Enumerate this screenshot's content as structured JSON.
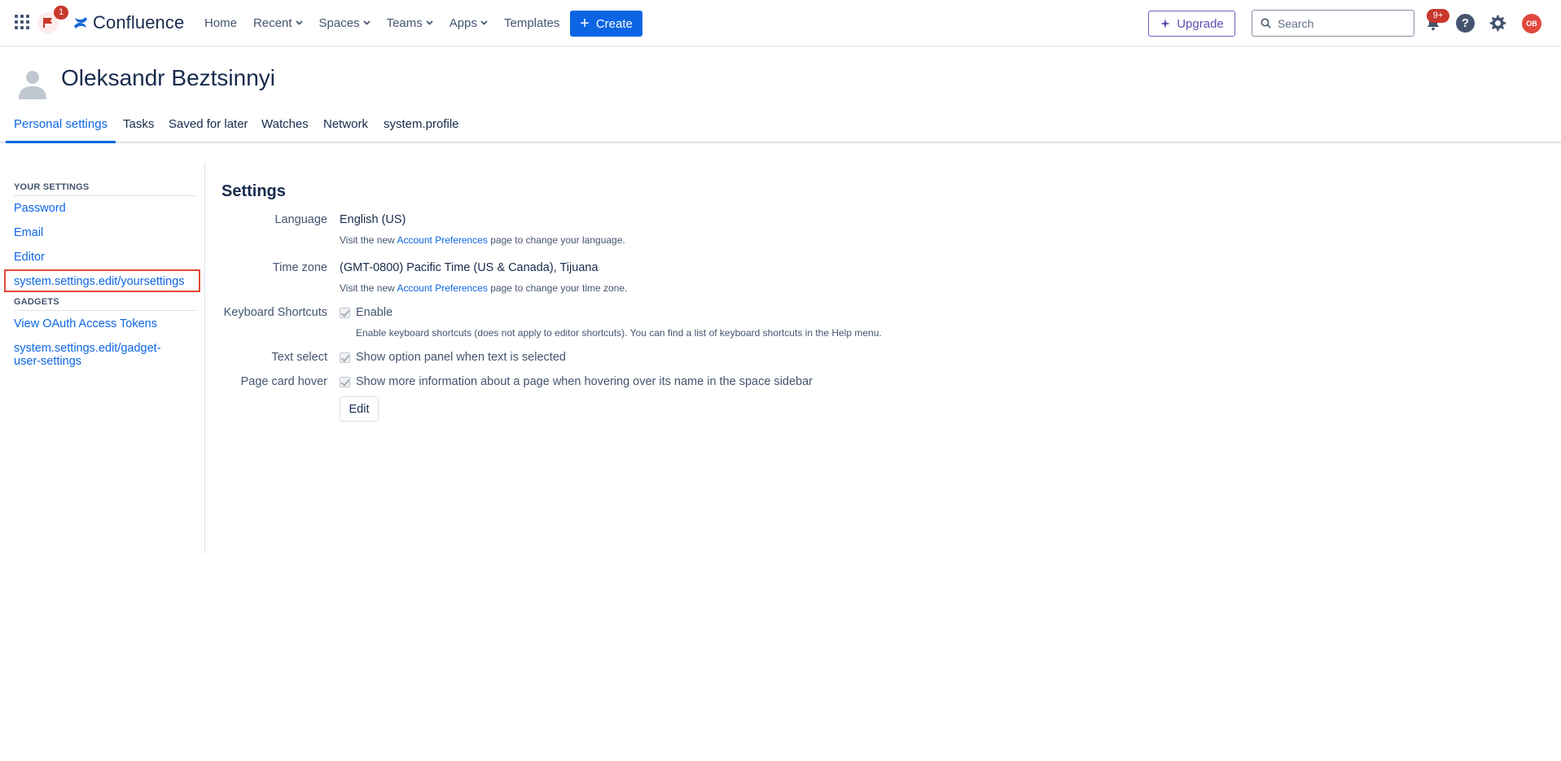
{
  "header": {
    "flag_badge": "1",
    "logo_text": "Confluence",
    "nav": [
      {
        "label": "Home"
      },
      {
        "label": "Recent"
      },
      {
        "label": "Spaces"
      },
      {
        "label": "Teams"
      },
      {
        "label": "Apps"
      },
      {
        "label": "Templates"
      }
    ],
    "create_label": "Create",
    "upgrade_label": "Upgrade",
    "search_placeholder": "Search",
    "notifications_badge": "9+",
    "help_label": "?",
    "avatar_initials": "OB"
  },
  "profile": {
    "name": "Oleksandr Beztsinnyi"
  },
  "tabs": [
    {
      "label": "Personal settings",
      "active": true
    },
    {
      "label": "Tasks"
    },
    {
      "label": "Saved for later"
    },
    {
      "label": "Watches"
    },
    {
      "label": "Network"
    },
    {
      "label": "system.profile"
    }
  ],
  "sidebar": {
    "your_settings_heading": "YOUR SETTINGS",
    "your_settings_items": [
      {
        "label": "Password"
      },
      {
        "label": "Email"
      },
      {
        "label": "Editor"
      },
      {
        "label": "system.settings.edit/yoursettings",
        "selected": true
      }
    ],
    "gadgets_heading": "GADGETS",
    "gadgets_items": [
      {
        "label": "View OAuth Access Tokens"
      },
      {
        "label": "system.settings.edit/gadget-user-settings"
      }
    ]
  },
  "settings": {
    "title": "Settings",
    "language": {
      "label": "Language",
      "value": "English (US)",
      "hint_prefix": "Visit the new",
      "hint_link": "Account Preferences",
      "hint_suffix": "page to change your language."
    },
    "timezone": {
      "label": "Time zone",
      "value": "(GMT-0800) Pacific Time (US & Canada), Tijuana",
      "hint_prefix": "Visit the new",
      "hint_link": "Account Preferences",
      "hint_suffix": "page to change your time zone."
    },
    "keyboard": {
      "label": "Keyboard Shortcuts",
      "checkbox_label": "Enable",
      "checked": true,
      "hint": "Enable keyboard shortcuts (does not apply to editor shortcuts). You can find a list of keyboard shortcuts in the Help menu."
    },
    "text_select": {
      "label": "Text select",
      "checkbox_label": "Show option panel when text is selected",
      "checked": true
    },
    "page_card": {
      "label": "Page card hover",
      "checkbox_label": "Show more information about a page when hovering over its name in the space sidebar",
      "checked": true
    },
    "edit_label": "Edit"
  },
  "colors": {
    "brand_blue": "#0c66e4",
    "upgrade_purple": "#5e4db2",
    "badge_red": "#c9372c",
    "selection_outline": "#e34935"
  },
  "icons": {
    "app_switcher": "grid-icon",
    "flag": "flag-icon",
    "logo": "confluence-logo-icon",
    "chevron": "chevron-down-icon",
    "search": "search-icon",
    "notifications": "bell-icon",
    "help": "help-icon",
    "settings": "gear-icon",
    "profile": "user-avatar-icon"
  }
}
